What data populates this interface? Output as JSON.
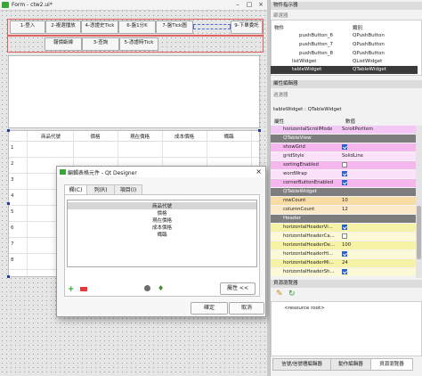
{
  "form": {
    "title": "Form - ctw2.ui*",
    "top_buttons": [
      "1-登入",
      "2-複選播放",
      "4-憑證史Tick",
      "6-盤1分K",
      "7-盤Tick圖",
      "",
      "9-下單委託"
    ],
    "second_buttons": [
      "報價斷線",
      "3-查詢",
      "5-憑證時Tick"
    ],
    "table": {
      "headers": [
        "商品代號",
        "價格",
        "現在價格",
        "成本價格",
        "幟臨"
      ],
      "rows": [
        "1",
        "2",
        "3",
        "4",
        "5",
        "6",
        "7",
        "8"
      ]
    }
  },
  "dialog": {
    "title": "編輯表格元件 - Qt Designer",
    "tabs": [
      "欄(C)",
      "列(R)",
      "項目(I)"
    ],
    "items": [
      "商品代號",
      "價格",
      "現在價格",
      "成本價格",
      "幟臨"
    ],
    "properties_button": "屬性 <<",
    "ok": "確定",
    "cancel": "取消"
  },
  "object_inspector": {
    "title": "物件指示器",
    "filter_placeholder": "篩選器",
    "columns": [
      "物件",
      "類別"
    ],
    "rows": [
      {
        "obj": "pushButton_6",
        "cls": "QPushButton"
      },
      {
        "obj": "pushButton_7",
        "cls": "QPushButton"
      },
      {
        "obj": "pushButton_8",
        "cls": "QPushButton"
      },
      {
        "obj": "listWidget",
        "cls": "QListWidget"
      },
      {
        "obj": "tableWidget",
        "cls": "QTableWidget"
      }
    ]
  },
  "property_editor": {
    "title": "屬性編輯器",
    "filter_placeholder": "過濾器",
    "context": "tableWidget : QTableWidget",
    "columns": [
      "屬性",
      "數值"
    ],
    "rows": [
      {
        "kind": "prop",
        "name": "horizontalScrollMode",
        "value": "ScrollPerItem",
        "color": "#f4c8f4"
      },
      {
        "kind": "group",
        "name": "QTableView"
      },
      {
        "kind": "prop",
        "name": "showGrid",
        "check": true,
        "color": "#f6b6ee"
      },
      {
        "kind": "prop",
        "name": "gridStyle",
        "value": "SolidLine",
        "color": "#fbe2fa"
      },
      {
        "kind": "prop",
        "name": "sortingEnabled",
        "check": false,
        "color": "#f6b6ee"
      },
      {
        "kind": "prop",
        "name": "wordWrap",
        "check": true,
        "color": "#fbe2fa"
      },
      {
        "kind": "prop",
        "name": "cornerButtonEnabled",
        "check": true,
        "color": "#f6b6ee"
      },
      {
        "kind": "group",
        "name": "QTableWidget"
      },
      {
        "kind": "prop",
        "name": "rowCount",
        "value": "10",
        "color": "#f8dca4"
      },
      {
        "kind": "prop",
        "name": "columnCount",
        "value": "12",
        "color": "#fbe9c7"
      },
      {
        "kind": "group",
        "name": "Header"
      },
      {
        "kind": "prop",
        "name": "horizontalHeaderVi...",
        "check": true,
        "color": "#f7f3a6"
      },
      {
        "kind": "prop",
        "name": "horizontalHeaderCa...",
        "check": false,
        "color": "#fbf9d6"
      },
      {
        "kind": "prop",
        "name": "horizontalHeaderDe...",
        "value": "100",
        "color": "#f7f3a6"
      },
      {
        "kind": "prop",
        "name": "horizontalHeaderHi...",
        "check": true,
        "color": "#fbf9d6"
      },
      {
        "kind": "prop",
        "name": "horizontalHeaderMi...",
        "value": "24",
        "color": "#f7f3a6"
      },
      {
        "kind": "prop",
        "name": "horizontalHeaderSh...",
        "check": true,
        "color": "#fbf9d6"
      }
    ]
  },
  "resource_browser": {
    "title": "資源瀏覽器",
    "root": "<resource root>"
  },
  "bottom_tabs": [
    "信號/信號槽編輯器",
    "動作編輯器",
    "資源瀏覽器"
  ]
}
